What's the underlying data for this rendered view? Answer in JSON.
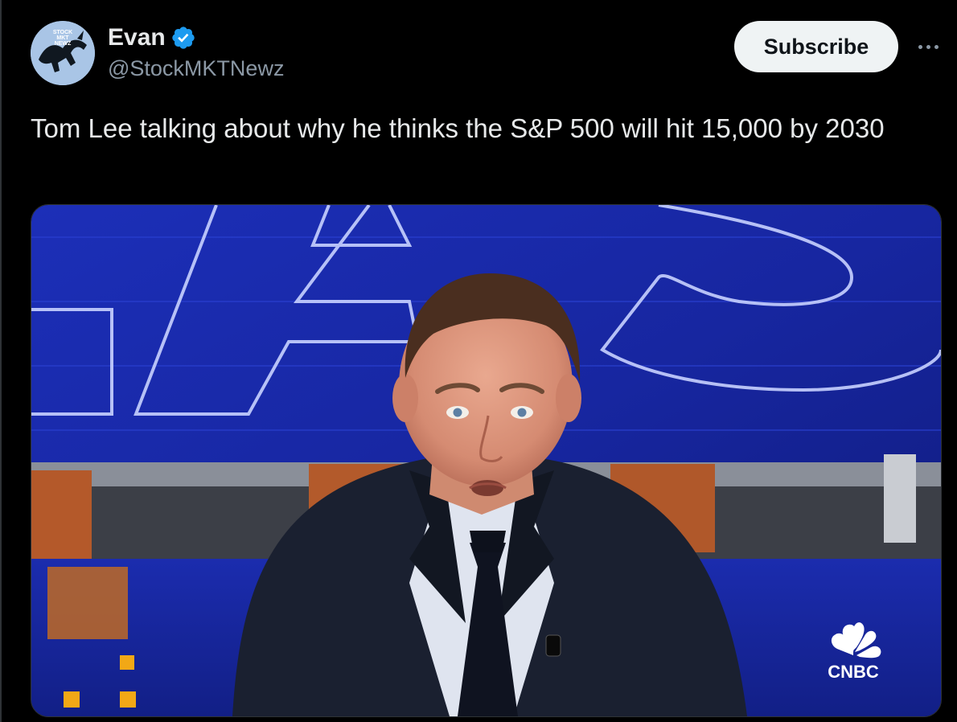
{
  "author": {
    "display_name": "Evan",
    "handle": "@StockMKTNewz",
    "avatar_text": [
      "STOCK",
      "MKT",
      "NEWZ"
    ],
    "verified": true
  },
  "actions": {
    "subscribe_label": "Subscribe",
    "more_icon": "more-horizontal-icon"
  },
  "post": {
    "text": "Tom Lee talking about why he thinks the S&P 500 will hit 15,000 by 2030"
  },
  "media": {
    "type": "video-frame",
    "network_logo_text": "CNBC",
    "subject": "Tom Lee"
  },
  "colors": {
    "background": "#000000",
    "text_primary": "#e7e9ea",
    "text_secondary": "#8b98a5",
    "verified_blue": "#1d9bf0",
    "button_bg": "#eff3f4",
    "studio_blue": "#1a2aa8"
  }
}
